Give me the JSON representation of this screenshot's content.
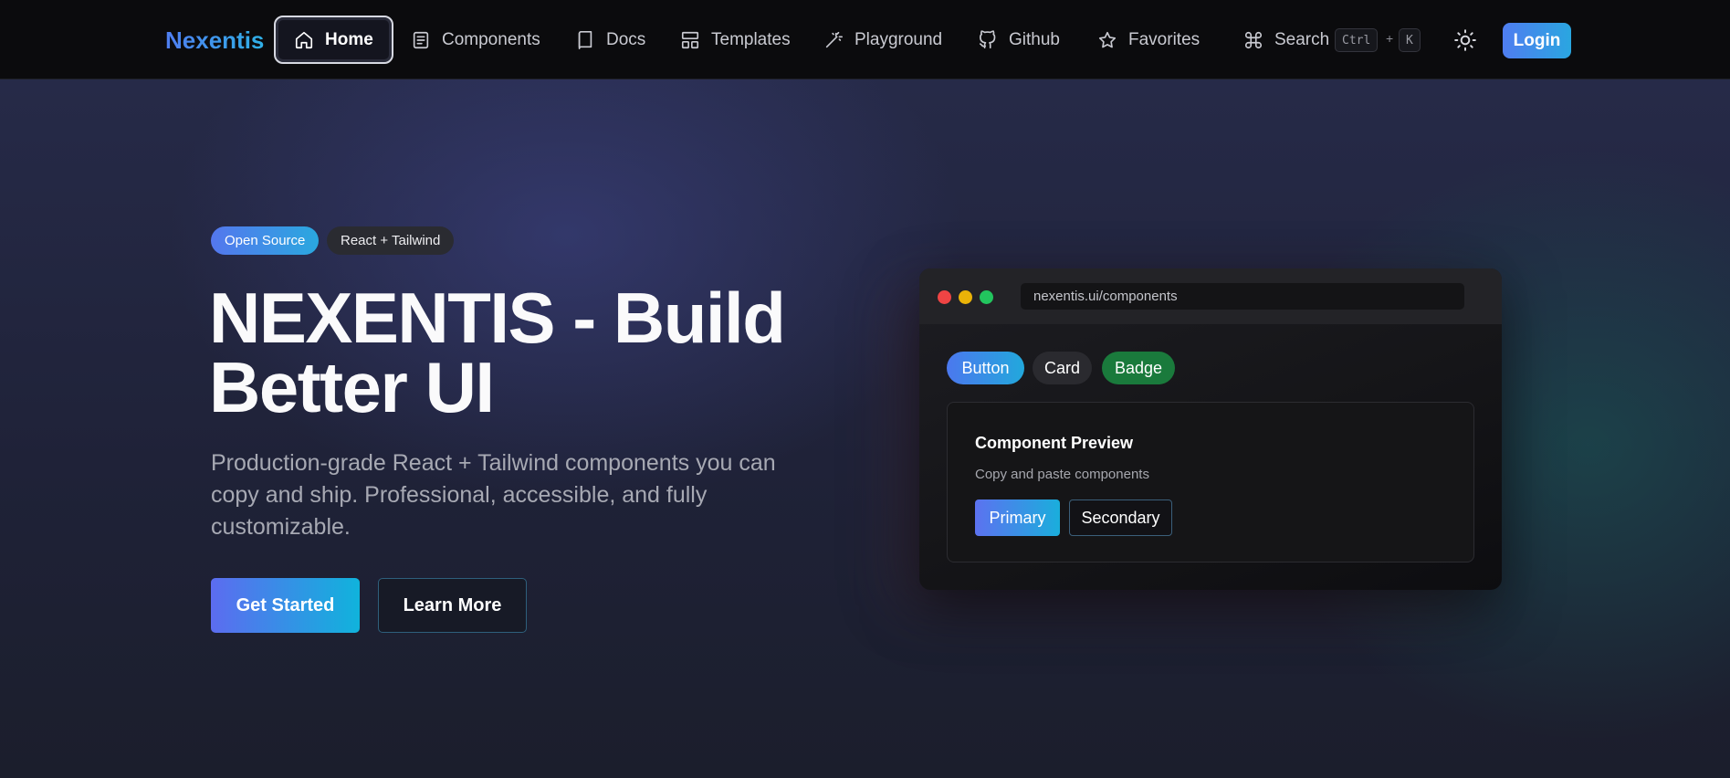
{
  "nav": {
    "brand": "Nexentis",
    "items": [
      {
        "label": "Home",
        "icon": "home-icon",
        "active": true
      },
      {
        "label": "Components",
        "icon": "document-icon",
        "active": false
      },
      {
        "label": "Docs",
        "icon": "book-icon",
        "active": false
      },
      {
        "label": "Templates",
        "icon": "layout-icon",
        "active": false
      },
      {
        "label": "Playground",
        "icon": "magic-wand-icon",
        "active": false
      },
      {
        "label": "Github",
        "icon": "github-icon",
        "active": false
      },
      {
        "label": "Favorites",
        "icon": "star-icon",
        "active": false
      }
    ],
    "search": {
      "label": "Search",
      "icon": "command-icon",
      "kbd_modifier": "Ctrl",
      "kbd_plus": "+",
      "kbd_key": "K"
    },
    "theme_toggle_icon": "sun-icon",
    "login_label": "Login"
  },
  "hero": {
    "badges": [
      "Open Source",
      "React + Tailwind"
    ],
    "title_line1": "NEXENTIS - Build",
    "title_line2": "Better UI",
    "subtitle": "Production-grade React + Tailwind components you can copy and ship. Professional, accessible, and fully customizable.",
    "cta_primary": "Get Started",
    "cta_secondary": "Learn More"
  },
  "preview": {
    "url": "nexentis.ui/components",
    "chips": [
      "Button",
      "Card",
      "Badge"
    ],
    "card_title": "Component Preview",
    "card_desc": "Copy and paste components",
    "card_primary": "Primary",
    "card_secondary": "Secondary"
  },
  "colors": {
    "accent_start": "#4f7df0",
    "accent_end": "#2aa6e0",
    "traffic_red": "#ef4444",
    "traffic_yellow": "#eab308",
    "traffic_green": "#22c55e",
    "badge_green": "#1a7a3c"
  }
}
